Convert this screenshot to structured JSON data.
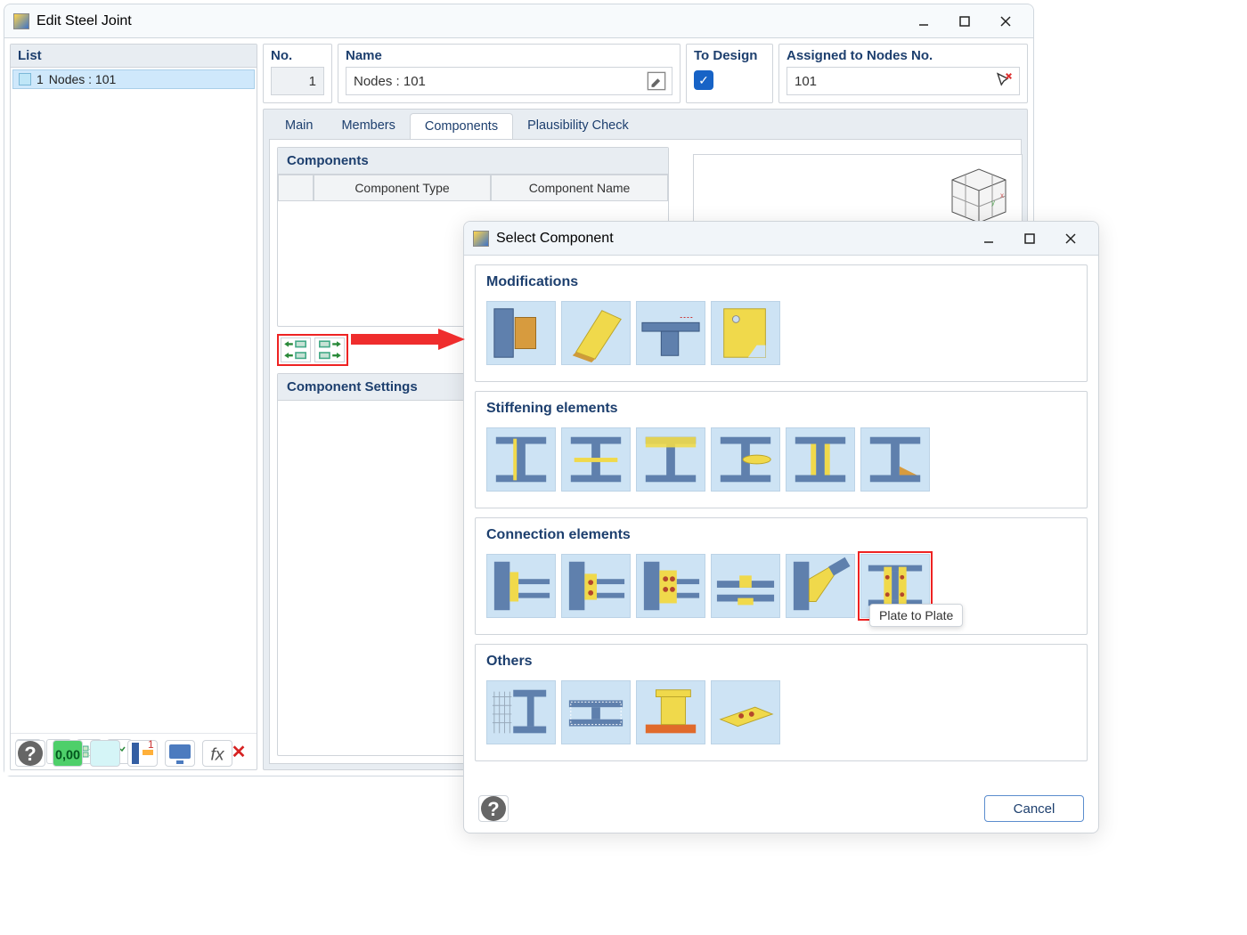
{
  "colors": {
    "accent": "#1d3f6e",
    "highlight": "#e22222"
  },
  "main": {
    "title": "Edit Steel Joint",
    "list": {
      "header": "List",
      "items": [
        {
          "index": "1",
          "label": "Nodes : 101"
        }
      ]
    },
    "header": {
      "no_label": "No.",
      "no_value": "1",
      "name_label": "Name",
      "name_value": "Nodes : 101",
      "design_label": "To Design",
      "design_checked": true,
      "nodes_label": "Assigned to Nodes No.",
      "nodes_value": "101"
    },
    "tabs": {
      "items": [
        "Main",
        "Members",
        "Components",
        "Plausibility Check"
      ],
      "active": "Components"
    },
    "components_panel": {
      "title": "Components",
      "cols": [
        "Component Type",
        "Component Name"
      ]
    },
    "settings_panel": {
      "title": "Component Settings"
    }
  },
  "child": {
    "title": "Select Component",
    "groups": {
      "modifications": "Modifications",
      "stiffening": "Stiffening elements",
      "connection": "Connection elements",
      "others": "Others"
    },
    "tooltip": "Plate to Plate",
    "cancel": "Cancel"
  }
}
